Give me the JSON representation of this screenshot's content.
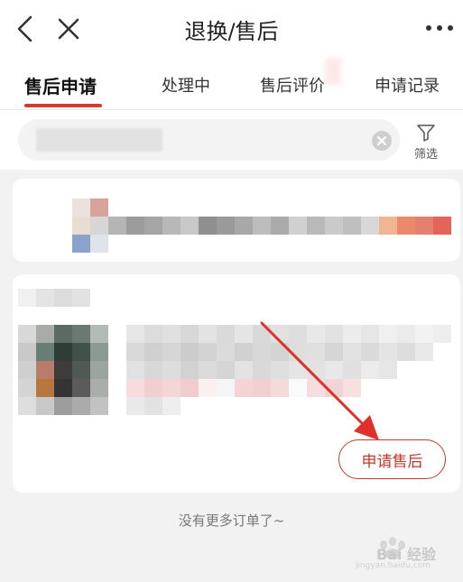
{
  "header": {
    "title": "退换/售后",
    "icons": {
      "back": "chevron-left-icon",
      "close": "close-icon",
      "more": "more-dots-icon"
    }
  },
  "tabs": [
    {
      "label": "售后申请",
      "active": true
    },
    {
      "label": "处理中",
      "active": false
    },
    {
      "label": "售后评价",
      "active": false
    },
    {
      "label": "申请记录",
      "active": false
    }
  ],
  "search": {
    "placeholder": "",
    "filter_label": "筛选",
    "icons": {
      "clear": "clear-icon",
      "filter": "funnel-icon"
    }
  },
  "order_card": {
    "apply_button_label": "申请售后"
  },
  "footer": {
    "end_text": "没有更多订单了~"
  },
  "watermark": {
    "text": "Bai 经验",
    "sub": "jingyan.baidu.com"
  },
  "colors": {
    "accent": "#d9392c",
    "apply_button": "#c0392b",
    "annotation_arrow": "#e0302a"
  }
}
